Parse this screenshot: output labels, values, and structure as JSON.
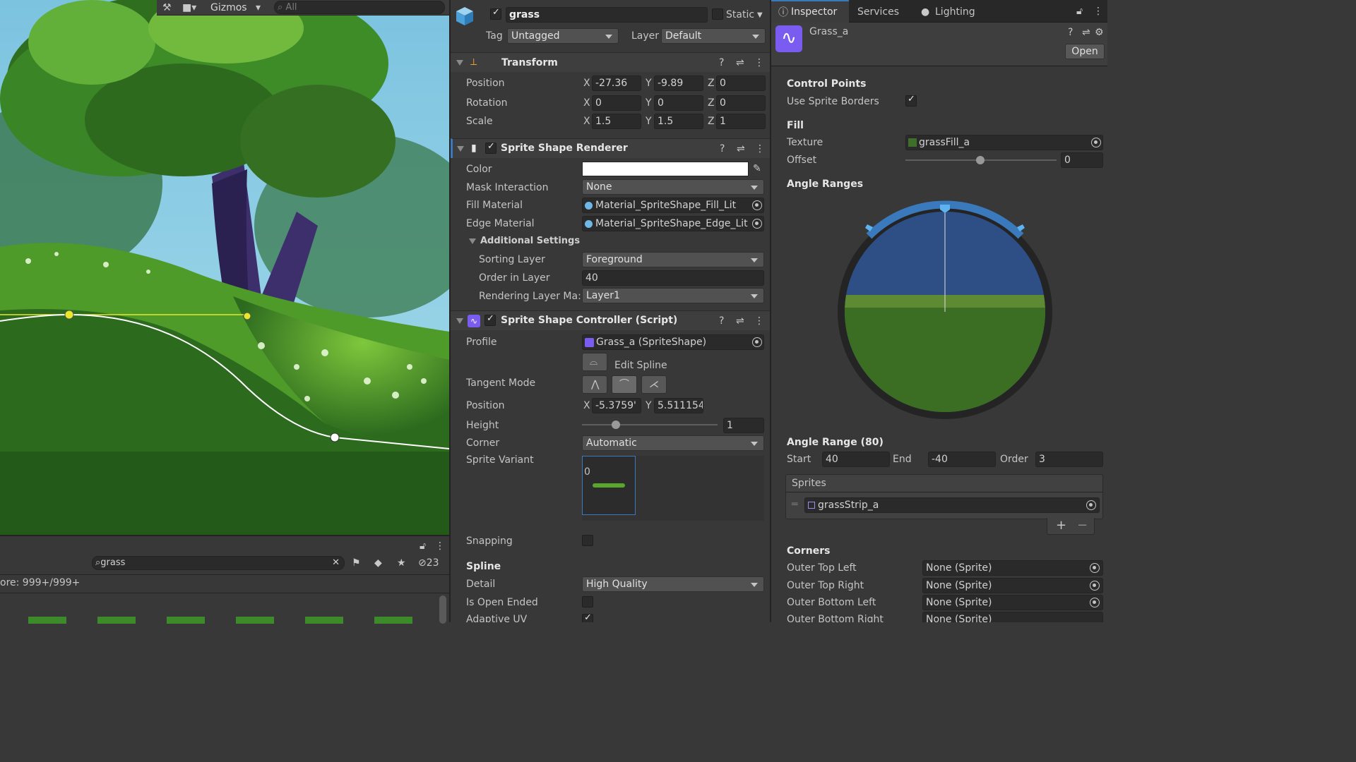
{
  "scene": {
    "gizmos_label": "Gizmos",
    "search_placeholder": "All"
  },
  "project": {
    "search_value": "grass",
    "count_label": "23",
    "footer_text": "ore: 999+/999+"
  },
  "inspector_left": {
    "object_name": "grass",
    "static_label": "Static",
    "tag_label": "Tag",
    "tag_value": "Untagged",
    "layer_label": "Layer",
    "layer_value": "Default",
    "transform": {
      "title": "Transform",
      "position_label": "Position",
      "rotation_label": "Rotation",
      "scale_label": "Scale",
      "position": {
        "x": "-27.36",
        "y": "-9.89",
        "z": "0"
      },
      "rotation": {
        "x": "0",
        "y": "0",
        "z": "0"
      },
      "scale": {
        "x": "1.5",
        "y": "1.5",
        "z": "1"
      }
    },
    "axes": {
      "x": "X",
      "y": "Y",
      "z": "Z"
    },
    "renderer": {
      "title": "Sprite Shape Renderer",
      "color_label": "Color",
      "mask_label": "Mask Interaction",
      "mask_value": "None",
      "fill_label": "Fill Material",
      "fill_value": "Material_SpriteShape_Fill_Lit",
      "edge_label": "Edge Material",
      "edge_value": "Material_SpriteShape_Edge_Lit",
      "additional": "Additional Settings",
      "sorting_label": "Sorting Layer",
      "sorting_value": "Foreground",
      "order_label": "Order in Layer",
      "order_value": "40",
      "rendering_label": "Rendering Layer Ma:",
      "rendering_value": "Layer1"
    },
    "controller": {
      "title": "Sprite Shape Controller (Script)",
      "profile_label": "Profile",
      "profile_value": "Grass_a (SpriteShape)",
      "edit_spline": "Edit Spline",
      "tangent_label": "Tangent Mode",
      "position_label": "Position",
      "pos_x": "-5.3759'",
      "pos_y": "5.511154",
      "height_label": "Height",
      "height_value": "1",
      "corner_label": "Corner",
      "corner_value": "Automatic",
      "variant_label": "Sprite Variant",
      "variant_index": "0",
      "snapping_label": "Snapping",
      "spline_header": "Spline",
      "detail_label": "Detail",
      "detail_value": "High Quality",
      "open_label": "Is Open Ended",
      "adaptive_label": "Adaptive UV"
    }
  },
  "tabs": {
    "inspector": "Inspector",
    "services": "Services",
    "lighting": "Lighting"
  },
  "asset": {
    "name": "Grass_a",
    "open_label": "Open",
    "control_points": "Control Points",
    "use_borders": "Use Sprite Borders",
    "fill": "Fill",
    "texture_label": "Texture",
    "texture_value": "grassFill_a",
    "offset_label": "Offset",
    "offset_value": "0",
    "angle_ranges": "Angle Ranges",
    "angle_range_title": "Angle Range (80)",
    "start_label": "Start",
    "start_value": "40",
    "end_label": "End",
    "end_value": "-40",
    "order_label": "Order",
    "order_value": "3",
    "sprites_label": "Sprites",
    "sprite_item": "grassStrip_a",
    "corners": "Corners",
    "corner_items": [
      {
        "label": "Outer Top Left",
        "value": "None (Sprite)"
      },
      {
        "label": "Outer Top Right",
        "value": "None (Sprite)"
      },
      {
        "label": "Outer Bottom Left",
        "value": "None (Sprite)"
      },
      {
        "label": "Outer Bottom Right",
        "value": "None (Sprite)"
      }
    ]
  },
  "colors": {
    "accent": "#3a79bb",
    "selection": "#2c5d87",
    "spline_yellow": "#e8e82a"
  }
}
